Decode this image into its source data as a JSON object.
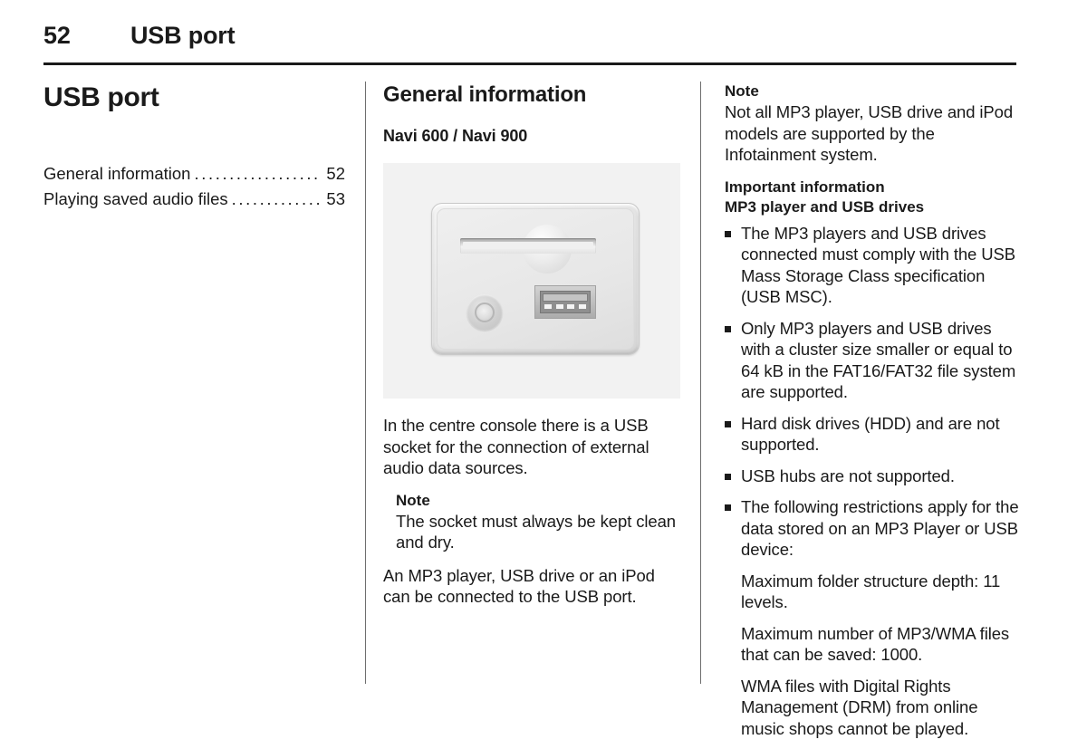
{
  "header": {
    "page_number": "52",
    "title": "USB port"
  },
  "left_column": {
    "chapter_title": "USB port",
    "toc": [
      {
        "label": "General information",
        "page": "52"
      },
      {
        "label": "Playing saved audio files",
        "page": "53"
      }
    ]
  },
  "middle_column": {
    "section_title": "General information",
    "subsection_title": "Navi 600 / Navi 900",
    "figure": {
      "caption_alt": "Centre console panel with card slot, AUX jack and USB socket",
      "parts": [
        "card-slot",
        "aux-jack",
        "usb-port"
      ]
    },
    "paragraph_1": "In the centre console there is a USB socket for the connection of external audio data sources.",
    "note_heading": "Note",
    "note_body": "The socket must always be kept clean and dry.",
    "paragraph_2": "An MP3 player, USB drive or an iPod can be connected to the USB port."
  },
  "right_column": {
    "note_heading": "Note",
    "note_body": "Not all MP3 player, USB drive and iPod models are supported by the Infotainment system.",
    "important_heading": "Important information",
    "important_subheading": "MP3 player and USB drives",
    "bullets": [
      "The MP3 players and USB drives connected must comply with the USB Mass Storage Class specification (USB MSC).",
      "Only MP3 players and USB drives with a cluster size smaller or equal to 64 kB in the FAT16/FAT32 file system are supported.",
      "Hard disk drives (HDD) and are not supported.",
      "USB hubs are not supported.",
      "The following restrictions apply for the data stored on an MP3 Player or USB device:"
    ],
    "sub_paragraphs": [
      "Maximum folder structure depth: 11 levels.",
      "Maximum number of MP3/WMA files that can be saved: 1000.",
      "WMA files with Digital Rights Management (DRM) from online music shops cannot be played."
    ]
  },
  "colors": {
    "text": "#1a1a1a",
    "rule": "#1a1a1a",
    "divider": "#6e6e6e",
    "figure_bg": "#f2f2f2"
  }
}
